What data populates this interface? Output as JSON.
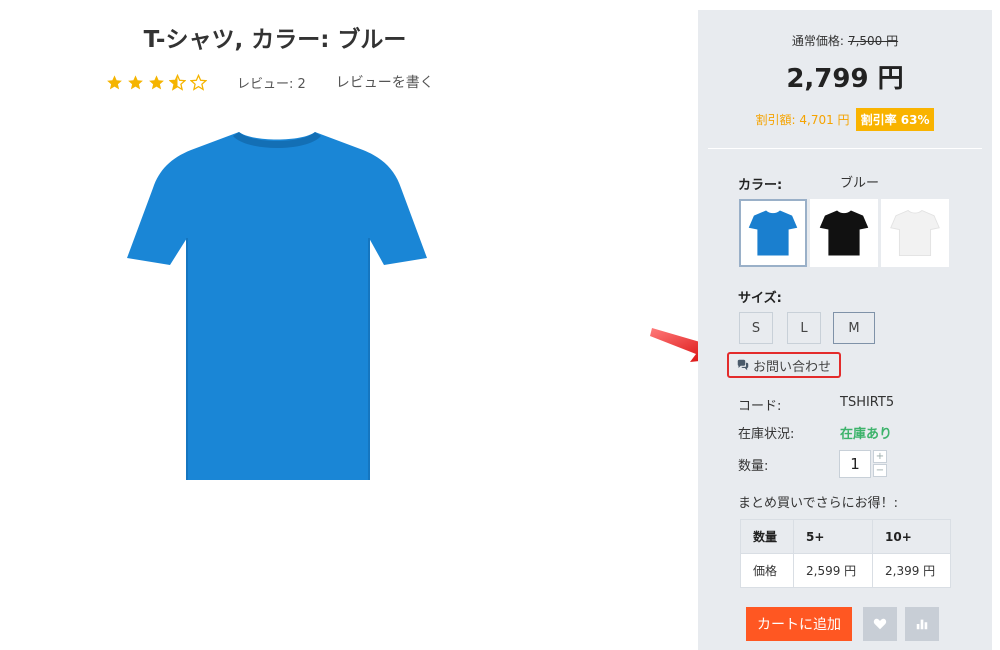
{
  "product": {
    "title": "T-シャツ, カラー: ブルー",
    "rating": 3.5,
    "rating_max": 5,
    "review_count_label": "レビュー: 2",
    "write_review_label": "レビューを書く",
    "image_icon": "tshirt-blue"
  },
  "pricing": {
    "regular_label": "通常価格:",
    "regular_value": "7,500 円",
    "price": "2,799 円",
    "discount_label": "割引額: 4,701 円",
    "discount_rate": "割引率 63%"
  },
  "color": {
    "label": "カラー:",
    "selected": "ブルー",
    "swatches": [
      {
        "name": "blue",
        "color": "#1a7fcf",
        "selected": true
      },
      {
        "name": "black",
        "color": "#111111",
        "selected": false
      },
      {
        "name": "white",
        "color": "#f2f2f2",
        "selected": false
      }
    ]
  },
  "size": {
    "label": "サイズ:",
    "options": [
      "S",
      "L",
      "M"
    ],
    "selected": "M"
  },
  "inquiry_label": "お問い合わせ",
  "details": {
    "code_label": "コード:",
    "code_value": "TSHIRT5",
    "stock_label": "在庫状況:",
    "stock_value": "在庫あり",
    "qty_label": "数量:",
    "qty_value": "1",
    "qty_plus": "+",
    "qty_minus": "−"
  },
  "bulk": {
    "label": "まとめ買いでさらにお得！:",
    "header": [
      "数量",
      "5+",
      "10+"
    ],
    "row": [
      "価格",
      "2,599 円",
      "2,399 円"
    ]
  },
  "actions": {
    "add_to_cart": "カートに追加",
    "wishlist_icon": "heart-icon",
    "compare_icon": "bar-chart-icon"
  },
  "colors": {
    "accent": "#ff5722",
    "discount": "#f9b300",
    "stock": "#3db36b",
    "highlight": "#e32b2b",
    "panel": "#e8ebef"
  }
}
